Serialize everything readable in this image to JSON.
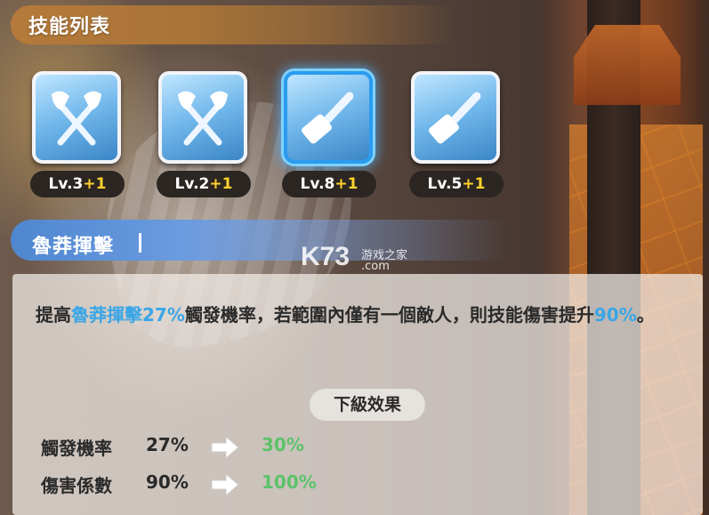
{
  "header": {
    "title": "技能列表"
  },
  "skills": [
    {
      "icon": "crossed-axes-icon",
      "level": "Lv.3",
      "bonus": "+1"
    },
    {
      "icon": "crossed-axes-icon",
      "level": "Lv.2",
      "bonus": "+1"
    },
    {
      "icon": "hammer-icon",
      "level": "Lv.8",
      "bonus": "+1",
      "selected": true
    },
    {
      "icon": "hammer-icon",
      "level": "Lv.5",
      "bonus": "+1"
    }
  ],
  "selected_skill": {
    "name": "魯莽揮擊"
  },
  "description": {
    "part1": "提高",
    "highlight1": "魯莽揮擊27%",
    "part2": "觸發機率，若範圍內僅有一個敵人，則技能傷害提升",
    "highlight2": "90%",
    "part3": "。"
  },
  "next_level": {
    "tab_label": "下級效果",
    "rows": [
      {
        "label": "觸發機率",
        "current": "27%",
        "next": "30%"
      },
      {
        "label": "傷害係數",
        "current": "90%",
        "next": "100%"
      }
    ]
  },
  "watermark": {
    "logo": "K73",
    "cn": "游戏之家",
    "domain": ".com"
  },
  "colors": {
    "highlight_blue": "#3aa6e6",
    "next_green": "#5cc36a",
    "bonus_yellow": "#ffd22e"
  }
}
